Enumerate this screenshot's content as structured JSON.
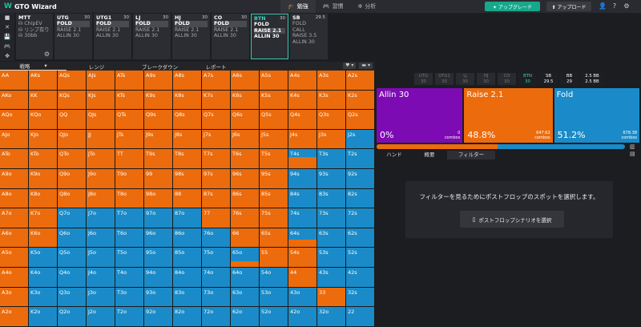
{
  "app": {
    "logo_mark": "W",
    "title": "GTO Wizard"
  },
  "nav": [
    {
      "icon": "🎓",
      "label": "勉強",
      "active": true
    },
    {
      "icon": "🎮",
      "label": "習慣",
      "active": false
    },
    {
      "icon": "✲",
      "label": "分析",
      "active": false
    }
  ],
  "header": {
    "upgrade_label": "✦ アップグレード",
    "upload_label": "⬆ アップロード"
  },
  "side_tools": [
    "■",
    "✕",
    "💾",
    "🎮",
    "✥"
  ],
  "positions": [
    {
      "name": "MTT",
      "stack": "",
      "lines": [
        "⛁ ChipEV",
        "⛁ リンプ有り",
        "⛁ 30bb"
      ],
      "type": "mtt"
    },
    {
      "name": "UTG",
      "stack": "30",
      "lines": [
        "FOLD",
        "RAISE 2.1",
        "ALLIN 30"
      ],
      "sel": 0
    },
    {
      "name": "UTG1",
      "stack": "30",
      "lines": [
        "FOLD",
        "RAISE 2.1",
        "ALLIN 30"
      ],
      "sel": 0
    },
    {
      "name": "LJ",
      "stack": "30",
      "lines": [
        "FOLD",
        "RAISE 2.1",
        "ALLIN 30"
      ],
      "sel": 0
    },
    {
      "name": "HJ",
      "stack": "30",
      "lines": [
        "FOLD",
        "RAISE 2.1",
        "ALLIN 30"
      ],
      "sel": 0
    },
    {
      "name": "CO",
      "stack": "30",
      "lines": [
        "FOLD",
        "RAISE 2.1",
        "ALLIN 30"
      ],
      "sel": 0
    },
    {
      "name": "BTN",
      "stack": "30",
      "lines": [
        "FOLD",
        "RAISE 2.1",
        "ALLIN 30"
      ],
      "sel": 1,
      "type": "btn"
    },
    {
      "name": "SB",
      "stack": "29.5",
      "lines": [
        "FOLD",
        "CALL",
        "RAISE 3.5",
        "ALLIN 30"
      ],
      "sel": -1
    }
  ],
  "tabs": [
    {
      "label": "戦略",
      "active": true
    },
    {
      "label": "レンジ",
      "active": false
    },
    {
      "label": "ブレークダウン",
      "active": false
    },
    {
      "label": "レポート",
      "active": false
    }
  ],
  "tab_tools": [
    "♥ ▾",
    "▬ ▾"
  ],
  "right_positions": [
    {
      "name": "UTG",
      "stack": "30",
      "style": "dim"
    },
    {
      "name": "UTG1",
      "stack": "30",
      "style": "dim"
    },
    {
      "name": "LJ",
      "stack": "30",
      "style": "dim"
    },
    {
      "name": "HJ",
      "stack": "30",
      "style": "dim"
    },
    {
      "name": "CO",
      "stack": "30",
      "style": "dim"
    },
    {
      "name": "BTN",
      "stack": "30",
      "style": "act"
    },
    {
      "name": "SB",
      "stack": "29.5",
      "style": "white"
    },
    {
      "name": "BB",
      "stack": "29",
      "style": "white"
    },
    {
      "name": "2.5 BB",
      "stack": "2.5 BB",
      "style": "white big"
    }
  ],
  "actions": [
    {
      "label": "Allin 30",
      "percent": "0%",
      "combos": "0",
      "combos_unit": "combos",
      "color": "#7d0bb3",
      "width": 108
    },
    {
      "label": "Raise 2.1",
      "percent": "48.8%",
      "combos": "647.62",
      "combos_unit": "combos",
      "color": "#ec6b0c",
      "width": 111
    },
    {
      "label": "Fold",
      "percent": "51.2%",
      "combos": "678.38",
      "combos_unit": "combos",
      "color": "#1a8bc8",
      "width": 107
    }
  ],
  "slider": {
    "raise_fraction": 0.488
  },
  "slider_icons": [
    "▥",
    "▤"
  ],
  "right_tabs": [
    {
      "label": "ハンド",
      "active": false
    },
    {
      "label": "概要",
      "active": false
    },
    {
      "label": "フィルター",
      "active": true
    }
  ],
  "filter": {
    "message": "フィルターを見るためにポストフロップのスポットを選択します。",
    "button_icon": "▯",
    "button_label": "ポストフロップシナリオを選択"
  },
  "colors": {
    "raise": "#ec6b0c",
    "fold": "#1a8bc8",
    "allin": "#7d0bb3",
    "accent": "#17a88b"
  },
  "grid": {
    "hands": [
      [
        "AA",
        "AKs",
        "AQs",
        "AJs",
        "ATs",
        "A9s",
        "A8s",
        "A7s",
        "A6s",
        "A5s",
        "A4s",
        "A3s",
        "A2s"
      ],
      [
        "AKo",
        "KK",
        "KQs",
        "KJs",
        "KTs",
        "K9s",
        "K8s",
        "K7s",
        "K6s",
        "K5s",
        "K4s",
        "K3s",
        "K2s"
      ],
      [
        "AQo",
        "KQo",
        "QQ",
        "QJs",
        "QTs",
        "Q9s",
        "Q8s",
        "Q7s",
        "Q6s",
        "Q5s",
        "Q4s",
        "Q3s",
        "Q2s"
      ],
      [
        "AJo",
        "KJo",
        "QJo",
        "JJ",
        "JTs",
        "J9s",
        "J8s",
        "J7s",
        "J6s",
        "J5s",
        "J4s",
        "J3s",
        "J2s"
      ],
      [
        "ATo",
        "KTo",
        "QTo",
        "JTo",
        "TT",
        "T9s",
        "T8s",
        "T7s",
        "T6s",
        "T5s",
        "T4s",
        "T3s",
        "T2s"
      ],
      [
        "A9o",
        "K9o",
        "Q9o",
        "J9o",
        "T9o",
        "99",
        "98s",
        "97s",
        "96s",
        "95s",
        "94s",
        "93s",
        "92s"
      ],
      [
        "A8o",
        "K8o",
        "Q8o",
        "J8o",
        "T8o",
        "98o",
        "88",
        "87s",
        "86s",
        "85s",
        "84s",
        "83s",
        "82s"
      ],
      [
        "A7o",
        "K7o",
        "Q7o",
        "J7o",
        "T7o",
        "97o",
        "87o",
        "77",
        "76s",
        "75s",
        "74s",
        "73s",
        "72s"
      ],
      [
        "A6o",
        "K6o",
        "Q6o",
        "J6o",
        "T6o",
        "96o",
        "86o",
        "76o",
        "66",
        "65s",
        "64s",
        "63s",
        "62s"
      ],
      [
        "A5o",
        "K5o",
        "Q5o",
        "J5o",
        "T5o",
        "95o",
        "85o",
        "75o",
        "65o",
        "55",
        "54s",
        "53s",
        "52s"
      ],
      [
        "A4o",
        "K4o",
        "Q4o",
        "J4o",
        "T4o",
        "94o",
        "84o",
        "74o",
        "64o",
        "54o",
        "44",
        "43s",
        "42s"
      ],
      [
        "A3o",
        "K3o",
        "Q3o",
        "J3o",
        "T3o",
        "93o",
        "83o",
        "73o",
        "63o",
        "53o",
        "43o",
        "33",
        "32s"
      ],
      [
        "A2o",
        "K2o",
        "Q2o",
        "J2o",
        "T2o",
        "92o",
        "82o",
        "72o",
        "62o",
        "52o",
        "42o",
        "32o",
        "22"
      ]
    ],
    "raise_freq": [
      [
        1,
        1,
        1,
        1,
        1,
        1,
        1,
        1,
        1,
        1,
        1,
        1,
        1
      ],
      [
        1,
        1,
        1,
        1,
        1,
        1,
        1,
        1,
        1,
        1,
        1,
        1,
        1
      ],
      [
        1,
        1,
        1,
        1,
        1,
        1,
        1,
        1,
        1,
        1,
        1,
        1,
        1
      ],
      [
        1,
        1,
        1,
        1,
        1,
        1,
        1,
        1,
        1,
        1,
        1,
        1,
        0
      ],
      [
        1,
        1,
        1,
        1,
        1,
        1,
        1,
        1,
        1,
        1,
        0.6,
        0,
        0
      ],
      [
        1,
        1,
        1,
        1,
        1,
        1,
        1,
        1,
        1,
        1,
        0,
        0,
        0
      ],
      [
        1,
        1,
        1,
        1,
        1,
        1,
        1,
        1,
        1,
        1,
        0,
        0,
        0
      ],
      [
        1,
        1,
        0,
        0,
        0,
        0,
        0,
        1,
        1,
        1,
        0,
        0,
        0
      ],
      [
        1,
        1,
        0,
        0,
        0,
        0,
        0,
        0,
        1,
        1,
        0.4,
        0,
        0
      ],
      [
        1,
        0,
        0,
        0,
        0,
        0,
        0,
        0,
        0.3,
        1,
        1,
        0,
        0
      ],
      [
        1,
        0,
        0,
        0,
        0,
        0,
        0,
        0,
        0,
        0,
        1,
        0,
        0
      ],
      [
        1,
        0,
        0,
        0,
        0,
        0,
        0,
        0,
        0,
        0,
        0,
        1,
        0
      ],
      [
        1,
        0,
        0,
        0,
        0,
        0,
        0,
        0,
        0,
        0,
        0,
        0,
        0
      ]
    ]
  }
}
